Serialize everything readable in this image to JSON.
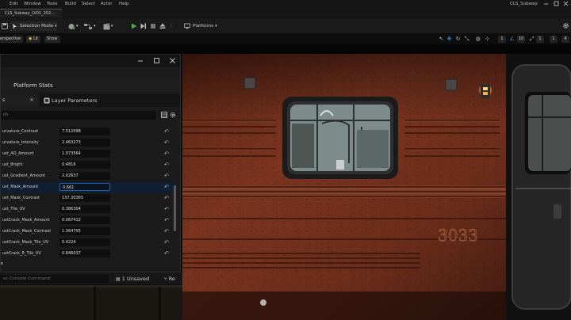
{
  "menu": {
    "items": [
      "Edit",
      "Window",
      "Tools",
      "Build",
      "Select",
      "Actor",
      "Help"
    ],
    "project_name": "CLS_Subway"
  },
  "level_tab": {
    "label": "CLS_Subway_LV01_202..."
  },
  "toolbar": {
    "mode_label": "Selection Mode",
    "platforms_label": "Platforms"
  },
  "viewport_bar": {
    "perspective_label": "erspective",
    "lit_label": "Lit",
    "show_label": "Show",
    "snap_values": [
      "1",
      "10",
      "1",
      "1",
      "4"
    ]
  },
  "panel": {
    "header_title": "Platform Stats",
    "tab_details": "s",
    "tab_layer_parameters": "Layer Parameters",
    "search_placeholder": "ch",
    "properties": [
      {
        "label": "urvature_Contrast",
        "value": "7.512098"
      },
      {
        "label": "urvature_Intensity",
        "value": "2.463273"
      },
      {
        "label": "ust_AO_Amount",
        "value": "1.073564"
      },
      {
        "label": "ust_Bright",
        "value": "0.4816"
      },
      {
        "label": "ust_Gradient_Amount",
        "value": "2.02637"
      },
      {
        "label": "ust_Mask_Amount",
        "value": "0.661"
      },
      {
        "label": "ust_Mask_Contrast",
        "value": "137.30365"
      },
      {
        "label": "ust_Tile_UV",
        "value": "0.386304"
      },
      {
        "label": "ustCrack_Mask_Amount",
        "value": "0.067412"
      },
      {
        "label": "ustCrack_Mask_Contrast",
        "value": "1.364705"
      },
      {
        "label": "ustCrack_Mask_Tile_UV",
        "value": "0.4224"
      },
      {
        "label": "ustCrack_R_Tile_UV",
        "value": "0.846037"
      }
    ],
    "footer_label": "e"
  },
  "status_bar": {
    "console_placeholder": "er Console Command",
    "unsaved_label": "1 Unsaved",
    "revision_label": "Re"
  },
  "viewport": {
    "car_number": "3033"
  },
  "colors": {
    "accent_blue": "#1f5fa8",
    "play_green": "#4caf50",
    "rust": "#6e2a18",
    "lamp": "#ffb347"
  }
}
